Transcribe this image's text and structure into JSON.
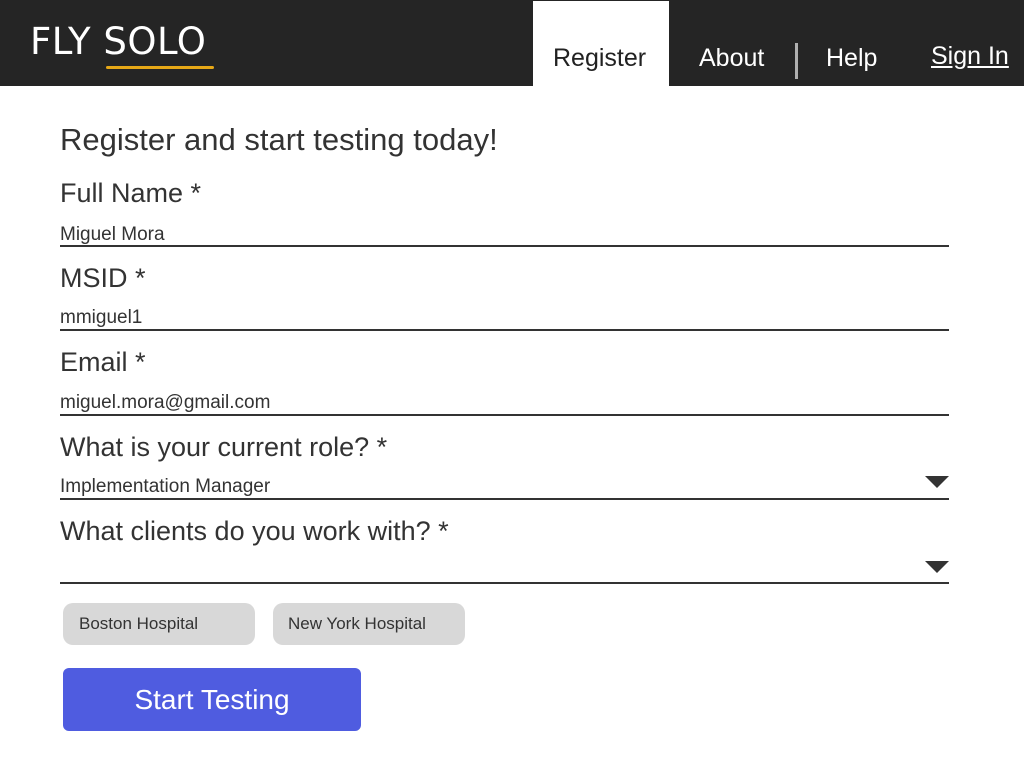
{
  "header": {
    "logo_text": "FLY SOLO",
    "nav": {
      "register": "Register",
      "about": "About",
      "help": "Help",
      "sign_in": "Sign In"
    }
  },
  "form": {
    "title": "Register and start testing today!",
    "full_name": {
      "label": "Full Name *",
      "value": "Miguel Mora"
    },
    "msid": {
      "label": "MSID *",
      "value": "mmiguel1"
    },
    "email": {
      "label": "Email *",
      "value": "miguel.mora@gmail.com"
    },
    "role": {
      "label": "What is your current role? *",
      "value": "Implementation Manager"
    },
    "clients": {
      "label": "What clients do you work with? *",
      "value": "",
      "selected": [
        "Boston Hospital",
        "New York Hospital"
      ]
    },
    "submit_label": "Start Testing"
  },
  "colors": {
    "header_bg": "#252525",
    "logo_accent": "#e7a817",
    "button_bg": "#4f5ce0",
    "chip_bg": "#d8d8d8"
  }
}
